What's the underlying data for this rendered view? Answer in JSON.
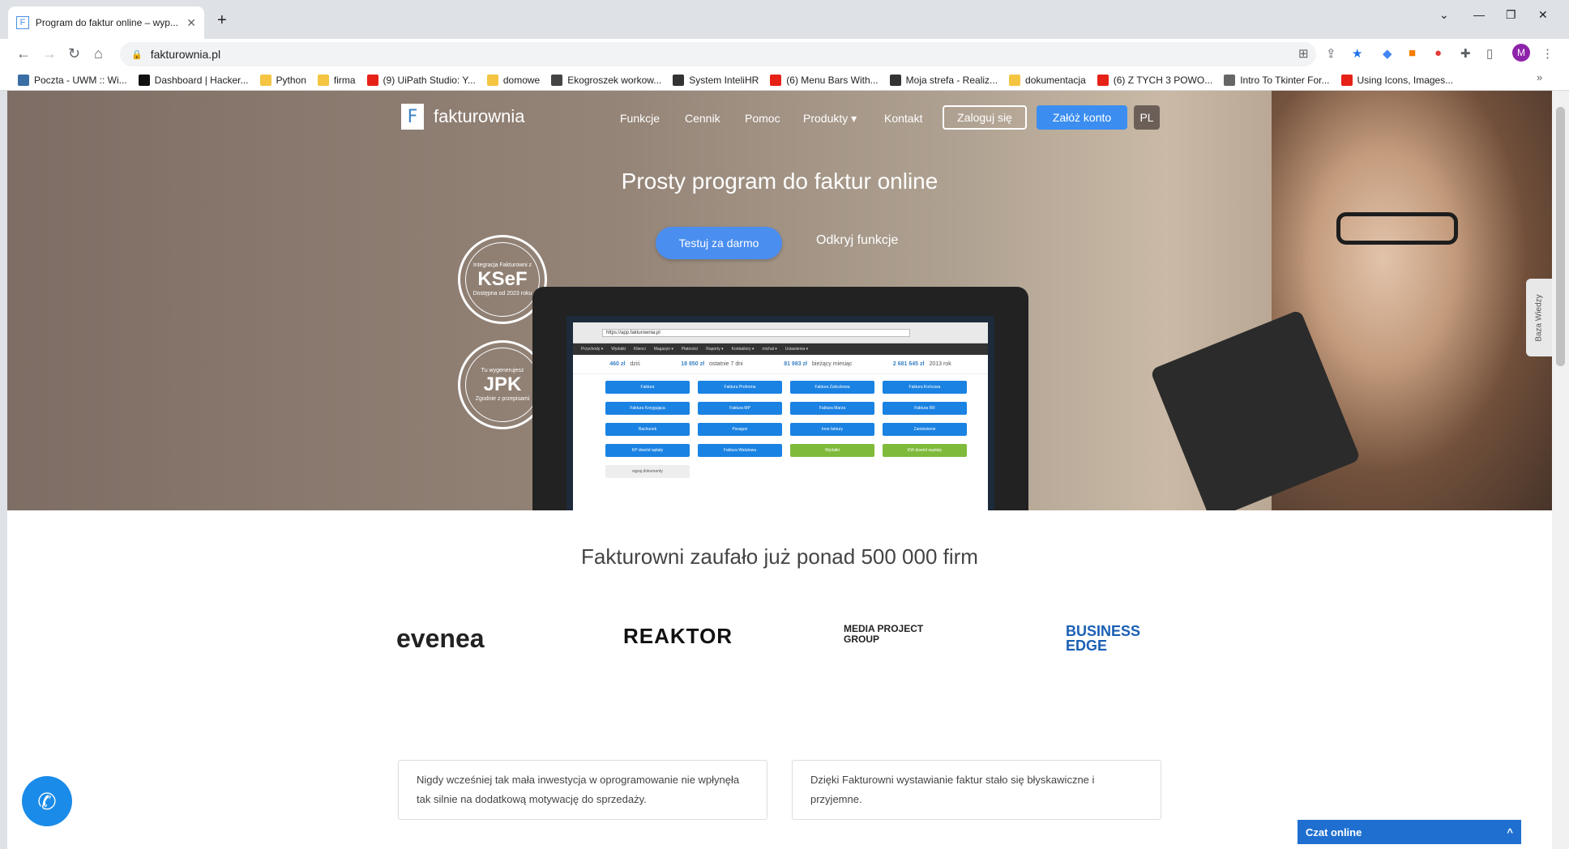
{
  "browser": {
    "tab_title": "Program do faktur online – wyp...",
    "tab_favicon_letter": "F",
    "url": "fakturownia.pl",
    "profile_initial": "M",
    "bookmarks": [
      {
        "label": "Poczta - UWM :: Wi...",
        "color": "#3a6ea5"
      },
      {
        "label": "Dashboard | Hacker...",
        "color": "#111111"
      },
      {
        "label": "Python",
        "color": "#f5c542"
      },
      {
        "label": "firma",
        "color": "#f5c542"
      },
      {
        "label": "(9) UiPath Studio: Y...",
        "color": "#e62117"
      },
      {
        "label": "domowe",
        "color": "#f5c542"
      },
      {
        "label": "Ekogroszek workow...",
        "color": "#444444"
      },
      {
        "label": "System InteliHR",
        "color": "#333333"
      },
      {
        "label": "(6) Menu Bars With...",
        "color": "#e62117"
      },
      {
        "label": "Moja strefa - Realiz...",
        "color": "#333333"
      },
      {
        "label": "dokumentacja",
        "color": "#f5c542"
      },
      {
        "label": "(6) Z TYCH 3 POWO...",
        "color": "#e62117"
      },
      {
        "label": "Intro To Tkinter For...",
        "color": "#666666"
      },
      {
        "label": "Using Icons, Images...",
        "color": "#e62117"
      }
    ],
    "bookmarks_more": "»"
  },
  "site": {
    "logo_letter": "F",
    "logo_name": "fakturownia",
    "menu": [
      "Funkcje",
      "Cennik",
      "Pomoc",
      "Produkty ▾",
      "Kontakt"
    ],
    "login_label": "Zaloguj się",
    "signup_label": "Załóż konto",
    "lang_label": "PL",
    "hero_title": "Prosty program do faktur online",
    "try_label": "Testuj za darmo",
    "discover_label": "Odkryj funkcje",
    "seal_ksef": {
      "top": "Integracja Fakturowni z",
      "big": "KSeF",
      "bottom": "Dostępna od 2023 roku"
    },
    "seal_jpk": {
      "top": "Tu wygenerujesz",
      "big": "JPK",
      "bottom": "Zgodnie z przepisami"
    },
    "app_preview": {
      "url": "https://app.fakturownia.pl",
      "nav": [
        "Przychody ▾",
        "Wydatki",
        "Klienci",
        "Magazyn ▾",
        "Płatności",
        "Raporty ▾",
        "Kontaktory ▾",
        "michał ▾",
        "Ustawienia ▾"
      ],
      "stats": [
        {
          "value": "460 zł",
          "label": "dziś"
        },
        {
          "value": "18 850 zł",
          "label": "ostatnie 7 dni"
        },
        {
          "value": "81 983 zł",
          "label": "bieżący miesiąc"
        },
        {
          "value": "2 681 645 zł",
          "label": "2013 rok"
        }
      ],
      "buttons": [
        {
          "label": "Faktura",
          "style": "blue"
        },
        {
          "label": "Faktura Proforma",
          "style": "blue"
        },
        {
          "label": "Faktura Zaliczkowa",
          "style": "blue"
        },
        {
          "label": "Faktura Końcowa",
          "style": "blue"
        },
        {
          "label": "Faktura Korygująca",
          "style": "blue"
        },
        {
          "label": "Faktura MP",
          "style": "blue"
        },
        {
          "label": "Faktura Marża",
          "style": "blue"
        },
        {
          "label": "Faktura RR",
          "style": "blue"
        },
        {
          "label": "Rachunek",
          "style": "blue"
        },
        {
          "label": "Paragon",
          "style": "blue"
        },
        {
          "label": "Inne faktury",
          "style": "blue"
        },
        {
          "label": "Zamówienie",
          "style": "blue"
        },
        {
          "label": "KP dowód wpłaty",
          "style": "blue"
        },
        {
          "label": "Faktura Walutowa",
          "style": "blue"
        },
        {
          "label": "Wydatki",
          "style": "green"
        },
        {
          "label": "KW dowód wypłaty",
          "style": "green"
        },
        {
          "label": "wgraj dokumenty",
          "style": "grey"
        }
      ]
    },
    "trust_text": "Fakturowni zaufało już ponad 500 000 firm",
    "client_logos": [
      "evenea",
      "REAKTOR",
      "MEDIA PROJECT GROUP",
      "BUSINESS EDGE"
    ],
    "testimonials": [
      "Nigdy wcześniej tak mała inwestycja w oprogramowanie nie wpłynęła tak silnie na dodatkową motywację do sprzedaży.",
      "Dzięki Fakturowni wystawianie faktur stało się błyskawiczne i przyjemne."
    ],
    "knowledge_tab": "Baza Wiedzy",
    "chat_label": "Czat online",
    "chat_toggle": "^"
  }
}
